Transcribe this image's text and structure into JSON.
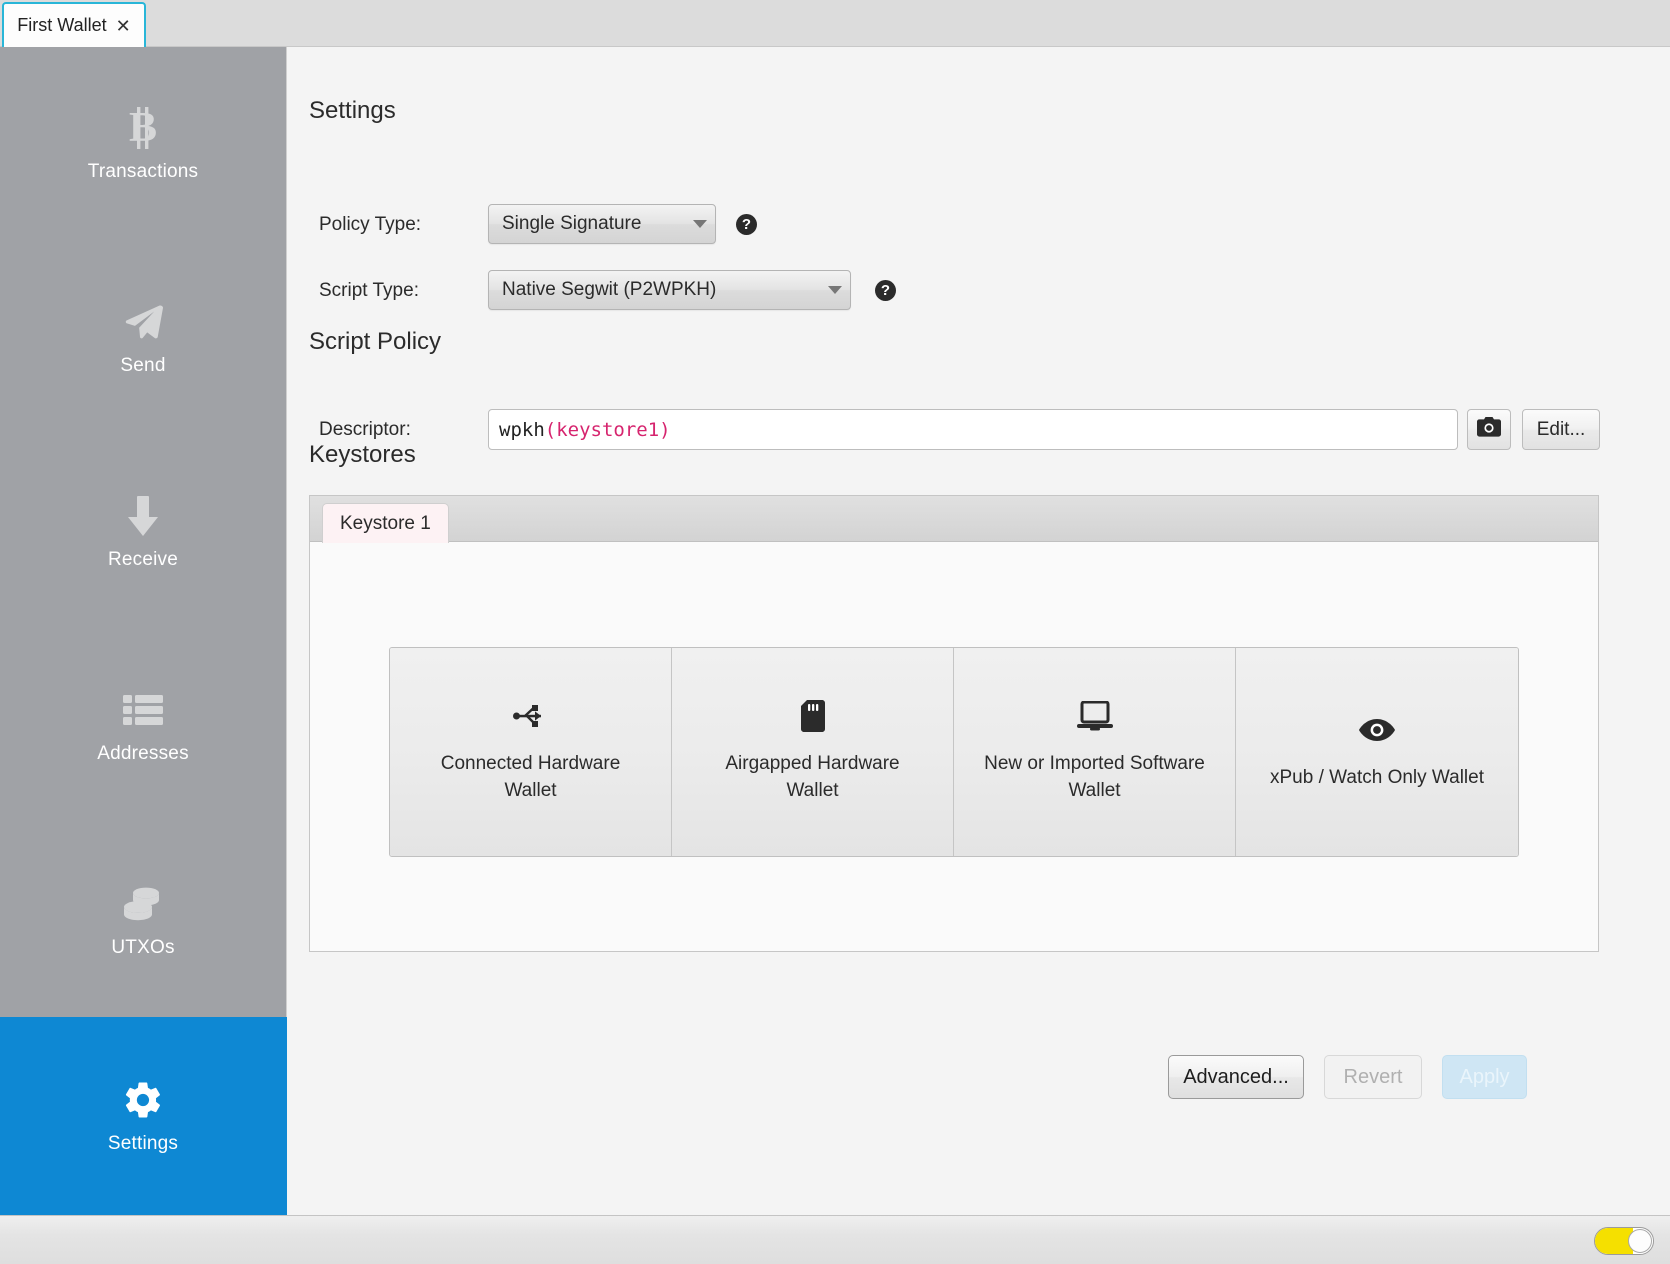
{
  "window": {
    "tab": {
      "label": "First Wallet",
      "close_glyph": "✕"
    }
  },
  "sidebar": {
    "items": [
      {
        "label": "Transactions",
        "icon": "bitcoin-icon",
        "selected": false
      },
      {
        "label": "Send",
        "icon": "send-paperplane-icon",
        "selected": false
      },
      {
        "label": "Receive",
        "icon": "down-arrow-icon",
        "selected": false
      },
      {
        "label": "Addresses",
        "icon": "list-icon",
        "selected": false
      },
      {
        "label": "UTXOs",
        "icon": "coins-stack-icon",
        "selected": false
      },
      {
        "label": "Settings",
        "icon": "gear-icon",
        "selected": true
      }
    ],
    "selected_color": "#0e88d3",
    "background_color": "#a0a2a6"
  },
  "settings": {
    "heading": "Settings",
    "policy_type": {
      "label": "Policy Type:",
      "value": "Single Signature",
      "help_glyph": "?"
    },
    "script_type": {
      "label": "Script Type:",
      "value": "Native Segwit (P2WPKH)",
      "help_glyph": "?"
    }
  },
  "script_policy": {
    "heading": "Script Policy",
    "descriptor": {
      "label": "Descriptor:",
      "function": "wpkh",
      "open_paren": "(",
      "key": "keystore1",
      "close_paren": ")",
      "full_value": "wpkh(keystore1)",
      "key_color": "#d6246e"
    },
    "camera_button": {
      "icon": "camera-icon"
    },
    "edit_button": {
      "label": "Edit..."
    }
  },
  "keystores": {
    "heading": "Keystores",
    "tabs": [
      {
        "label": "Keystore 1",
        "active": true
      }
    ],
    "options": [
      {
        "label": "Connected Hardware Wallet",
        "icon": "usb-icon"
      },
      {
        "label": "Airgapped Hardware Wallet",
        "icon": "sdcard-icon"
      },
      {
        "label": "New or Imported Software Wallet",
        "icon": "laptop-icon"
      },
      {
        "label": "xPub / Watch Only Wallet",
        "icon": "eye-icon"
      }
    ]
  },
  "footer": {
    "advanced": {
      "label": "Advanced...",
      "state": "enabled"
    },
    "revert": {
      "label": "Revert",
      "state": "disabled"
    },
    "apply": {
      "label": "Apply",
      "state": "disabled"
    }
  },
  "statusbar": {
    "toggle": {
      "state": "on",
      "color": "#f5e000"
    }
  }
}
